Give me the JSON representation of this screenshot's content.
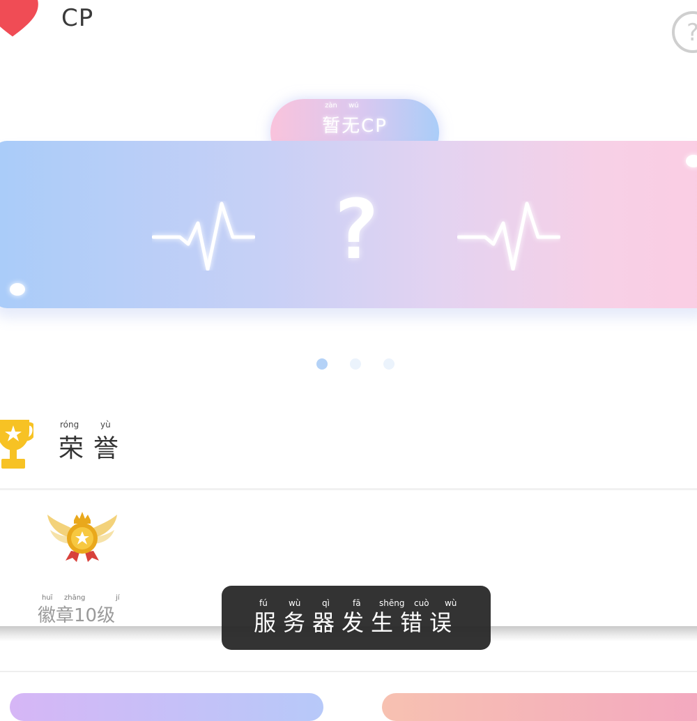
{
  "header": {
    "title": "CP",
    "left_icon": "heart-icon",
    "right_icon": "help-question-icon"
  },
  "status": {
    "label": "暂无CP",
    "pinyin": [
      "zàn",
      "wú"
    ]
  },
  "banner": {
    "center_symbol": "?",
    "left_icon": "heartbeat-pulse-icon",
    "right_icon": "heartbeat-pulse-icon"
  },
  "carousel": {
    "active_index": 0,
    "count": 3
  },
  "honor": {
    "title": "荣誉",
    "pinyin": [
      "róng",
      "yù"
    ],
    "icon": "trophy-icon"
  },
  "badge": {
    "label": "徽章10级",
    "pinyin": [
      "huī",
      "zhāng",
      "jí"
    ],
    "icon": "winged-medal-icon"
  },
  "toast": {
    "message": "服务器发生错误",
    "pinyin": [
      "fú",
      "wù",
      "qì",
      "fā",
      "shēng",
      "cuò",
      "wù"
    ]
  },
  "colors": {
    "heart": "#f04c55",
    "banner_left": "#a9ccf9",
    "banner_right": "#fbcde3",
    "dot_active": "#b4d2f7",
    "dot_inactive": "#ebf3fc",
    "trophy": "#f7c224",
    "toast_bg": "#262626"
  }
}
